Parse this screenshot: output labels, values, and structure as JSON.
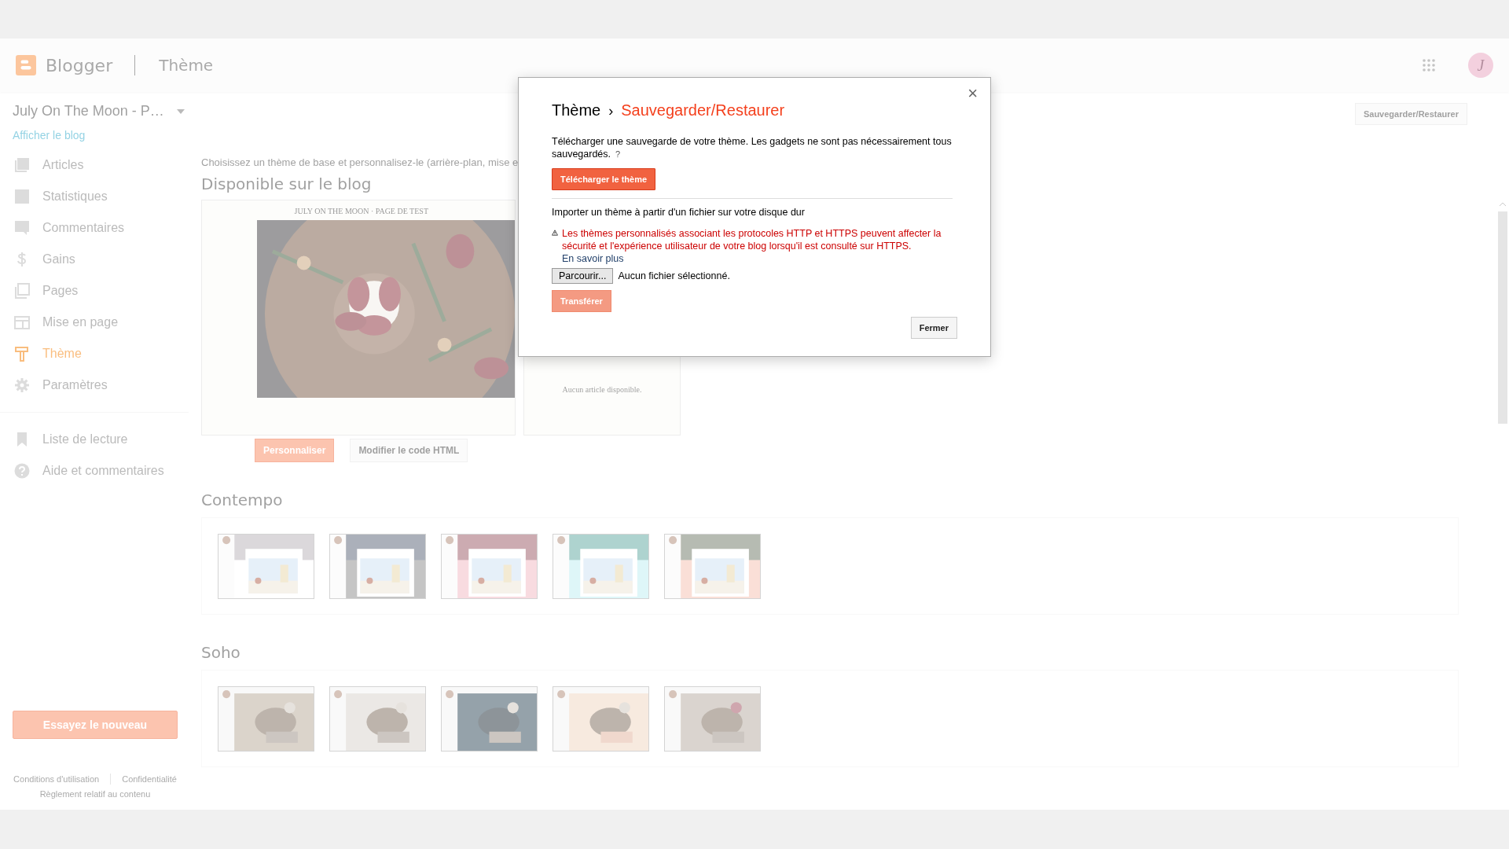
{
  "header": {
    "logo": "Blogger",
    "section": "Thème",
    "avatar": "J"
  },
  "blog": {
    "name": "July On The Moon - P…",
    "view_link": "Afficher le blog"
  },
  "nav": [
    {
      "label": "Articles",
      "selected": false
    },
    {
      "label": "Statistiques",
      "selected": false
    },
    {
      "label": "Commentaires",
      "selected": false
    },
    {
      "label": "Gains",
      "selected": false
    },
    {
      "label": "Pages",
      "selected": false
    },
    {
      "label": "Mise en page",
      "selected": false
    },
    {
      "label": "Thème",
      "selected": true
    },
    {
      "label": "Paramètres",
      "selected": false
    }
  ],
  "nav_secondary": [
    {
      "label": "Liste de lecture"
    },
    {
      "label": "Aide et commentaires"
    }
  ],
  "try_button": "Essayez le nouveau",
  "footer_links": [
    "Conditions d'utilisation",
    "Confidentialité",
    "Règlement relatif au contenu"
  ],
  "content": {
    "intro": "Choisissez un thème de base et personnalisez-le (arrière-plan, mise e",
    "live_heading": "Disponible sur le blog",
    "preview_title": "JULY ON THE MOON · PAGE DE TEST",
    "mobile_text": "Aucun article disponible.",
    "customize_button": "Personnaliser",
    "edit_html_button": "Modifier le code HTML",
    "backup_button": "Sauvegarder/Restaurer"
  },
  "theme_groups": [
    {
      "name": "Contempo"
    },
    {
      "name": "Soho"
    }
  ],
  "dialog": {
    "breadcrumb_root": "Thème",
    "breadcrumb_sep": "›",
    "title": "Sauvegarder/Restaurer",
    "close": "×",
    "download_text": "Télécharger une sauvegarde de votre thème. Les gadgets ne sont pas nécessairement tous sauvegardés.",
    "help": "?",
    "download_button": "Télécharger le thème",
    "import_text": "Importer un thème à partir d'un fichier sur votre disque dur",
    "warning": "Les thèmes personnalisés associant les protocoles HTTP et HTTPS peuvent affecter la sécurité et l'expérience utilisateur de votre blog lorsqu'il est consulté sur HTTPS.",
    "learn_more": "En savoir plus",
    "browse_button": "Parcourir...",
    "file_status": "Aucun fichier sélectionné.",
    "upload_button": "Transférer",
    "upload_disabled": true,
    "close_button": "Fermer"
  }
}
